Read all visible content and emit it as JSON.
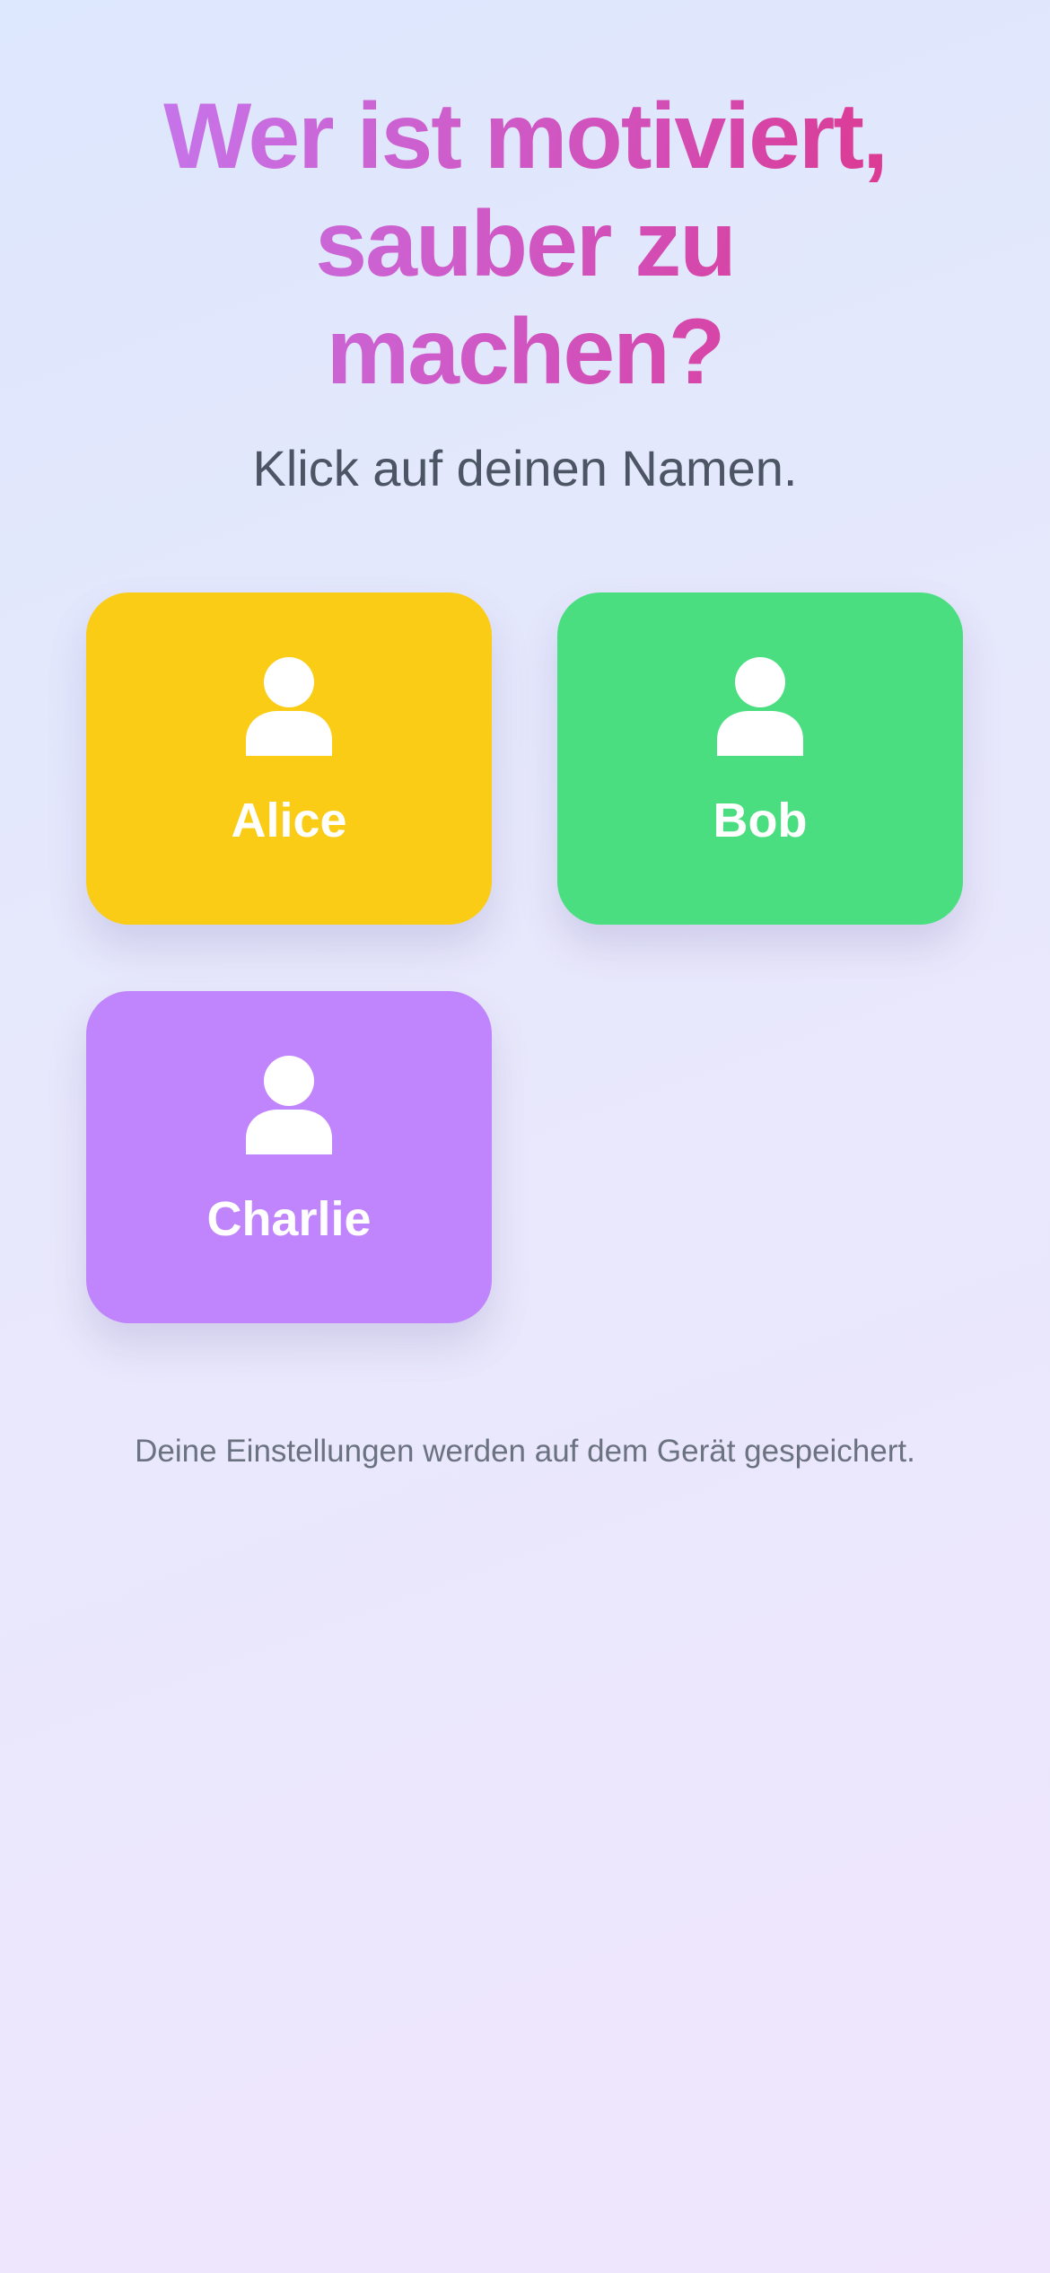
{
  "header": {
    "title_line1": "Wer ist motiviert,",
    "title_line2": "sauber zu",
    "title_line3": "machen?",
    "subtitle": "Klick auf deinen Namen."
  },
  "users": [
    {
      "name": "Alice",
      "color": "#facc15",
      "icon": "user-icon"
    },
    {
      "name": "Bob",
      "color": "#4ade80",
      "icon": "user-icon"
    },
    {
      "name": "Charlie",
      "color": "#c084fc",
      "icon": "user-icon"
    }
  ],
  "footer": {
    "note": "Deine Einstellungen werden auf dem Gerät gespeichert."
  }
}
